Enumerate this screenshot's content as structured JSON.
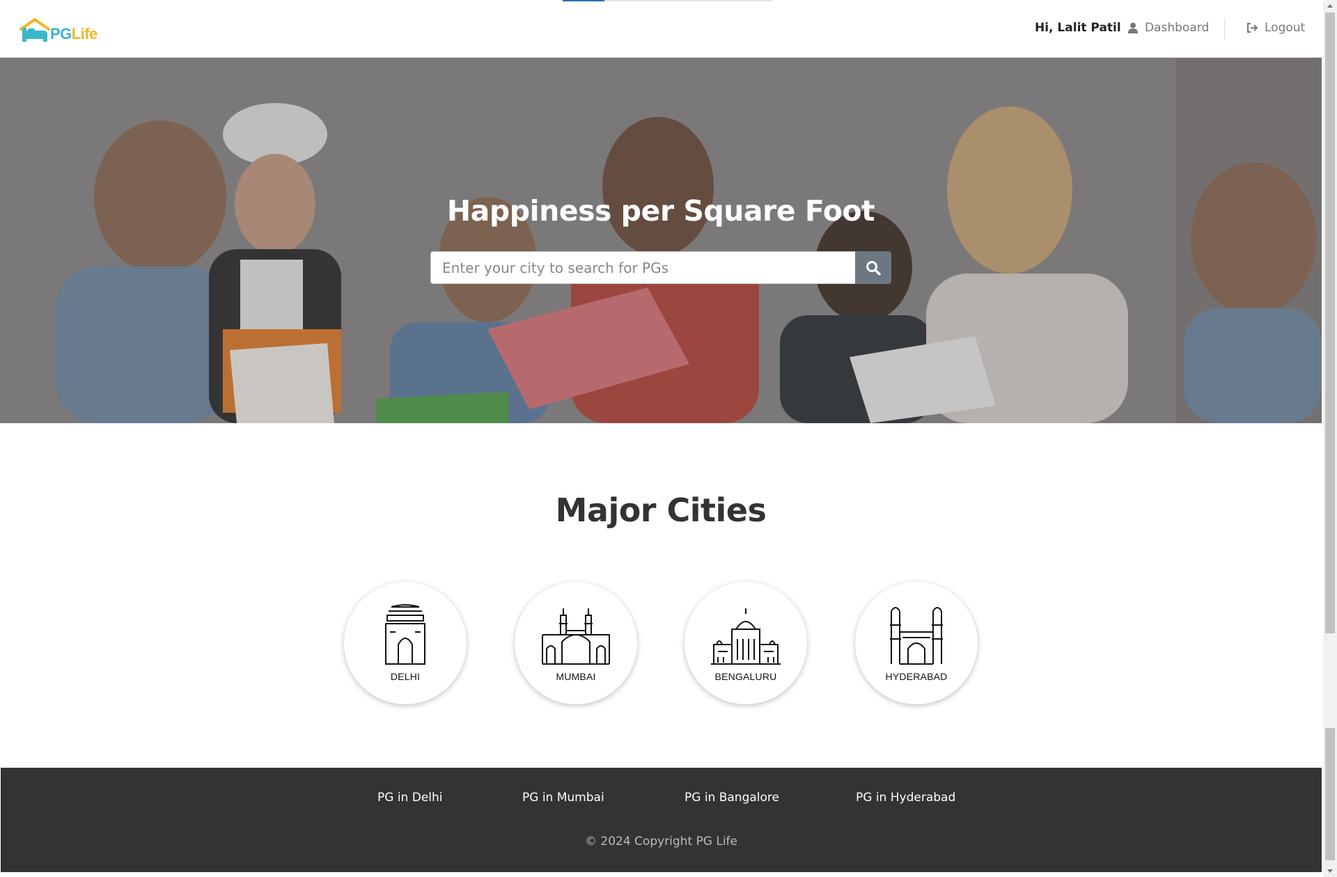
{
  "brand": {
    "pg": "PG",
    "life": "Life"
  },
  "nav": {
    "greeting": "Hi, Lalit Patil",
    "dashboard": "Dashboard",
    "logout": "Logout"
  },
  "loading_progress": 0.2,
  "hero": {
    "title": "Happiness per Square Foot",
    "search_placeholder": "Enter your city to search for PGs"
  },
  "cities": {
    "title": "Major Cities",
    "items": [
      {
        "label": "DELHI",
        "icon": "india-gate-icon"
      },
      {
        "label": "MUMBAI",
        "icon": "gateway-of-india-icon"
      },
      {
        "label": "BENGALURU",
        "icon": "vidhana-soudha-icon"
      },
      {
        "label": "HYDERABAD",
        "icon": "charminar-icon"
      }
    ]
  },
  "footer": {
    "links": [
      "PG in Delhi",
      "PG in Mumbai",
      "PG in Bangalore",
      "PG in Hyderabad"
    ],
    "copyright": "© 2024 Copyright PG Life"
  },
  "colors": {
    "brand_teal": "#3ab7c7",
    "brand_yellow": "#f5b324",
    "footer_bg": "#333333",
    "search_button": "#6c7782"
  }
}
